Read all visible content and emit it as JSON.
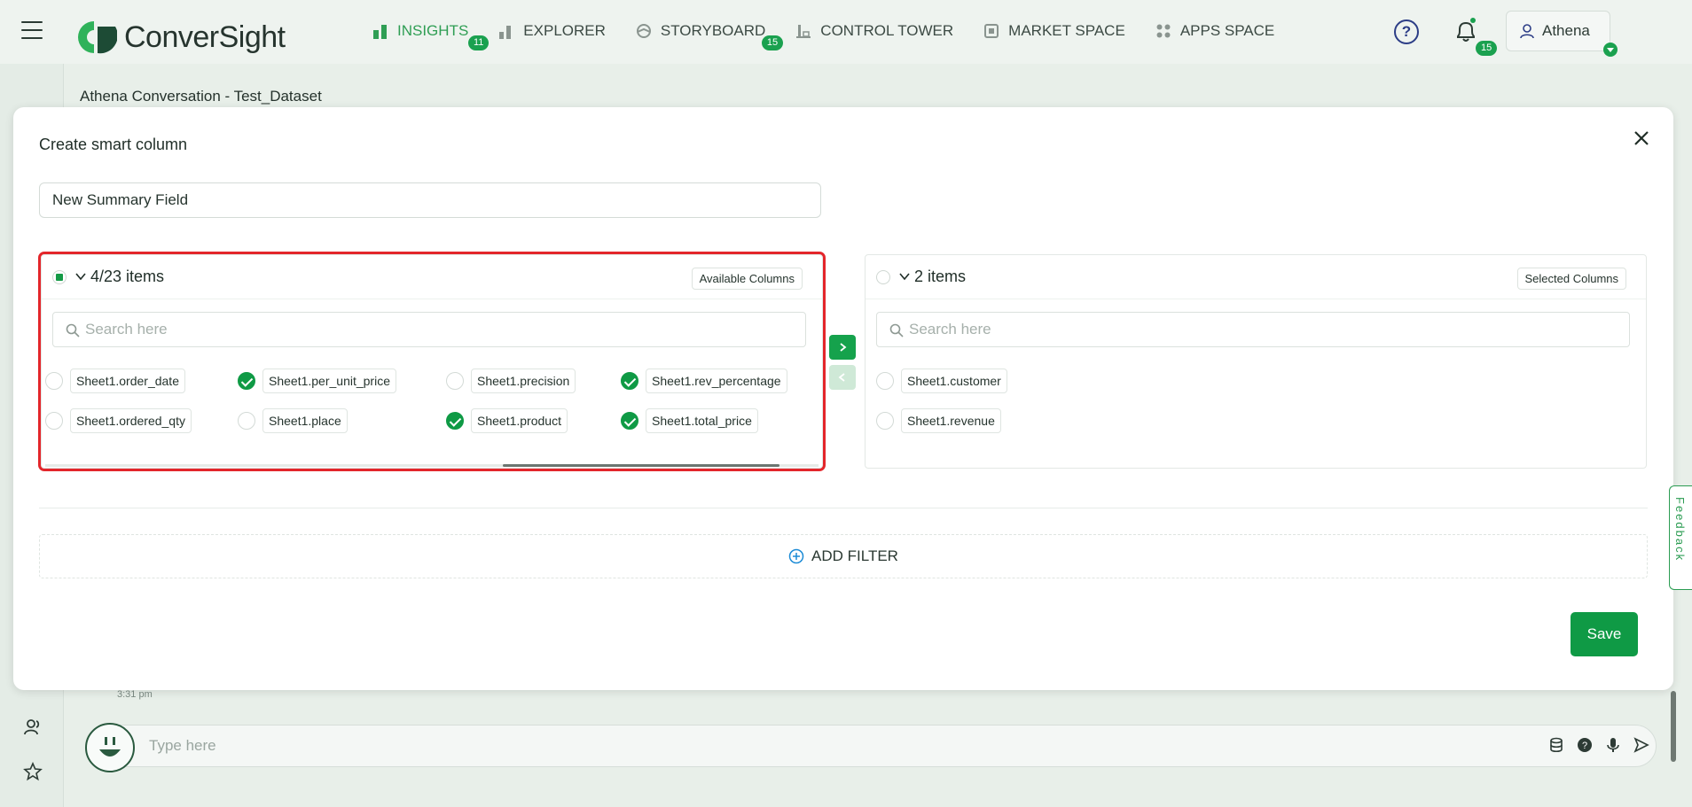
{
  "app": {
    "brand": "ConverSight",
    "colors": {
      "primary": "#0f9a45",
      "highlight": "#e3262b",
      "accent": "#2f9e54"
    }
  },
  "nav": {
    "items": [
      {
        "label": "INSIGHTS",
        "icon": "bar-chart-icon",
        "badge": "11",
        "active": true
      },
      {
        "label": "EXPLORER",
        "icon": "explorer-icon",
        "badge": ""
      },
      {
        "label": "STORYBOARD",
        "icon": "storyboard-icon",
        "badge": "15"
      },
      {
        "label": "CONTROL TOWER",
        "icon": "control-tower-icon",
        "badge": ""
      },
      {
        "label": "MARKET SPACE",
        "icon": "market-space-icon",
        "badge": ""
      },
      {
        "label": "APPS SPACE",
        "icon": "apps-space-icon",
        "badge": ""
      }
    ],
    "help": "?",
    "notifications_badge": "15",
    "user": "Athena"
  },
  "background": {
    "conversation_title": "Athena Conversation - Test_Dataset",
    "timestamp": "3:31 pm",
    "chat_placeholder": "Type here"
  },
  "modal": {
    "title": "Create smart column",
    "name_value": "New Summary Field",
    "left_panel": {
      "count": "4/23 items",
      "tag": "Available Columns",
      "search_placeholder": "Search here",
      "items": [
        {
          "label": "Sheet1.order_date",
          "checked": false
        },
        {
          "label": "Sheet1.per_unit_price",
          "checked": true
        },
        {
          "label": "Sheet1.precision",
          "checked": false
        },
        {
          "label": "Sheet1.rev_percentage",
          "checked": true
        },
        {
          "label": "Sheet1.ordered_qty",
          "checked": false
        },
        {
          "label": "Sheet1.place",
          "checked": false
        },
        {
          "label": "Sheet1.product",
          "checked": true
        },
        {
          "label": "Sheet1.total_price",
          "checked": true
        }
      ]
    },
    "right_panel": {
      "count": "2 items",
      "tag": "Selected Columns",
      "search_placeholder": "Search here",
      "items": [
        {
          "label": "Sheet1.customer",
          "checked": false
        },
        {
          "label": "Sheet1.revenue",
          "checked": false
        }
      ]
    },
    "add_filter": "ADD FILTER",
    "save": "Save"
  },
  "feedback": "Feedback"
}
